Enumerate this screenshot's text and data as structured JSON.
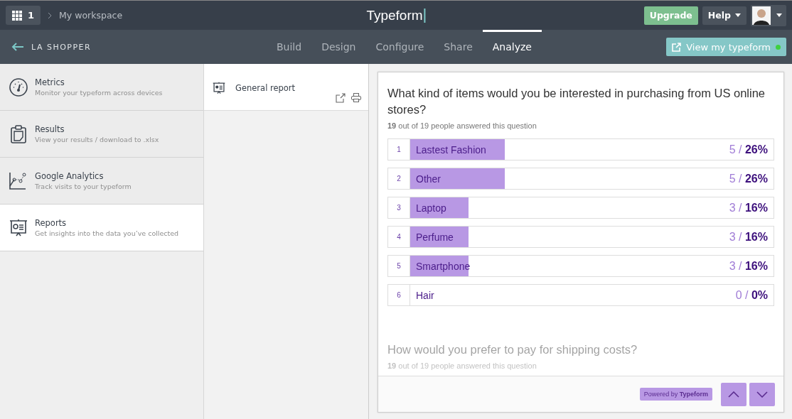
{
  "topbar": {
    "apps_count": "1",
    "breadcrumb": "My workspace",
    "logo": "Typeform",
    "upgrade": "Upgrade",
    "help": "Help"
  },
  "subbar": {
    "back_label": "LA SHOPPER",
    "tabs": [
      {
        "label": "Build",
        "selected": false
      },
      {
        "label": "Design",
        "selected": false
      },
      {
        "label": "Configure",
        "selected": false
      },
      {
        "label": "Share",
        "selected": false
      },
      {
        "label": "Analyze",
        "selected": true
      }
    ],
    "view_button": "View my typeform",
    "live": true
  },
  "sidebar": {
    "items": [
      {
        "kind": "gauge",
        "title": "Metrics",
        "subtitle": "Monitor your typeform across devices",
        "selected": false
      },
      {
        "kind": "clipboard",
        "title": "Results",
        "subtitle": "View your results / download to .xlsx",
        "selected": false
      },
      {
        "kind": "plot",
        "title": "Google Analytics",
        "subtitle": "Track visits to your typeform",
        "selected": false
      },
      {
        "kind": "board",
        "title": "Reports",
        "subtitle": "Get insights into the data you’ve collected",
        "selected": true
      }
    ]
  },
  "reports": {
    "items": [
      {
        "title": "General report"
      }
    ]
  },
  "report": {
    "questions": [
      {
        "title": "What kind of items would you be interested in purchasing from US online stores?",
        "answered": "**19** out of 19 people answered this question",
        "answers": [
          {
            "index": "1",
            "label": "Lastest Fashion",
            "result": "5 / **26%**",
            "level": 0.26
          },
          {
            "index": "2",
            "label": "Other",
            "result": "5 / **26%**",
            "level": 0.26
          },
          {
            "index": "3",
            "label": "Laptop",
            "result": "3 / **16%**",
            "level": 0.16
          },
          {
            "index": "4",
            "label": "Perfume",
            "result": "3 / **16%**",
            "level": 0.16
          },
          {
            "index": "5",
            "label": "Smartphone",
            "result": "3 / **16%**",
            "level": 0.16
          },
          {
            "index": "6",
            "label": "Hair",
            "result": "0 / **0%**",
            "level": 0
          }
        ]
      },
      {
        "title": "How would you prefer to pay for shipping costs?",
        "answered": "**19** out of 19 people answered this question"
      }
    ],
    "powered_by": "Powered by **Typeform**"
  }
}
